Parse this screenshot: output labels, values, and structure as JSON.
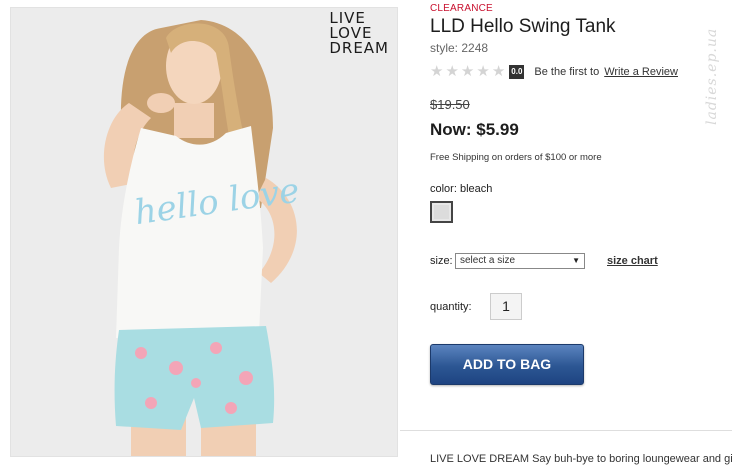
{
  "product_image": {
    "brand_lines": [
      "LIVE",
      "LOVE",
      "DREAM"
    ],
    "shirt_print": "hello love"
  },
  "product": {
    "badge": "CLEARANCE",
    "title": "LLD Hello Swing Tank",
    "style": "style: 2248"
  },
  "rating": {
    "stars": 0,
    "max_stars": 5,
    "score": "0.0",
    "prompt": "Be the first to",
    "link": "Write a Review"
  },
  "pricing": {
    "was": "$19.50",
    "now": "Now: $5.99",
    "shipping": "Free Shipping on orders of $100 or more"
  },
  "color": {
    "label": "color: bleach",
    "swatch_color": "#dcdcdc"
  },
  "size": {
    "label": "size:",
    "selected": "select a size",
    "chart_link": "size chart"
  },
  "quantity": {
    "label": "quantity:",
    "value": "1"
  },
  "actions": {
    "add_to_bag": "ADD TO BAG",
    "accent": "#2c5693"
  },
  "description": {
    "text": "LIVE LOVE DREAM Say buh-bye to boring loungewear and give"
  },
  "watermark": "ladies.ep.ua"
}
